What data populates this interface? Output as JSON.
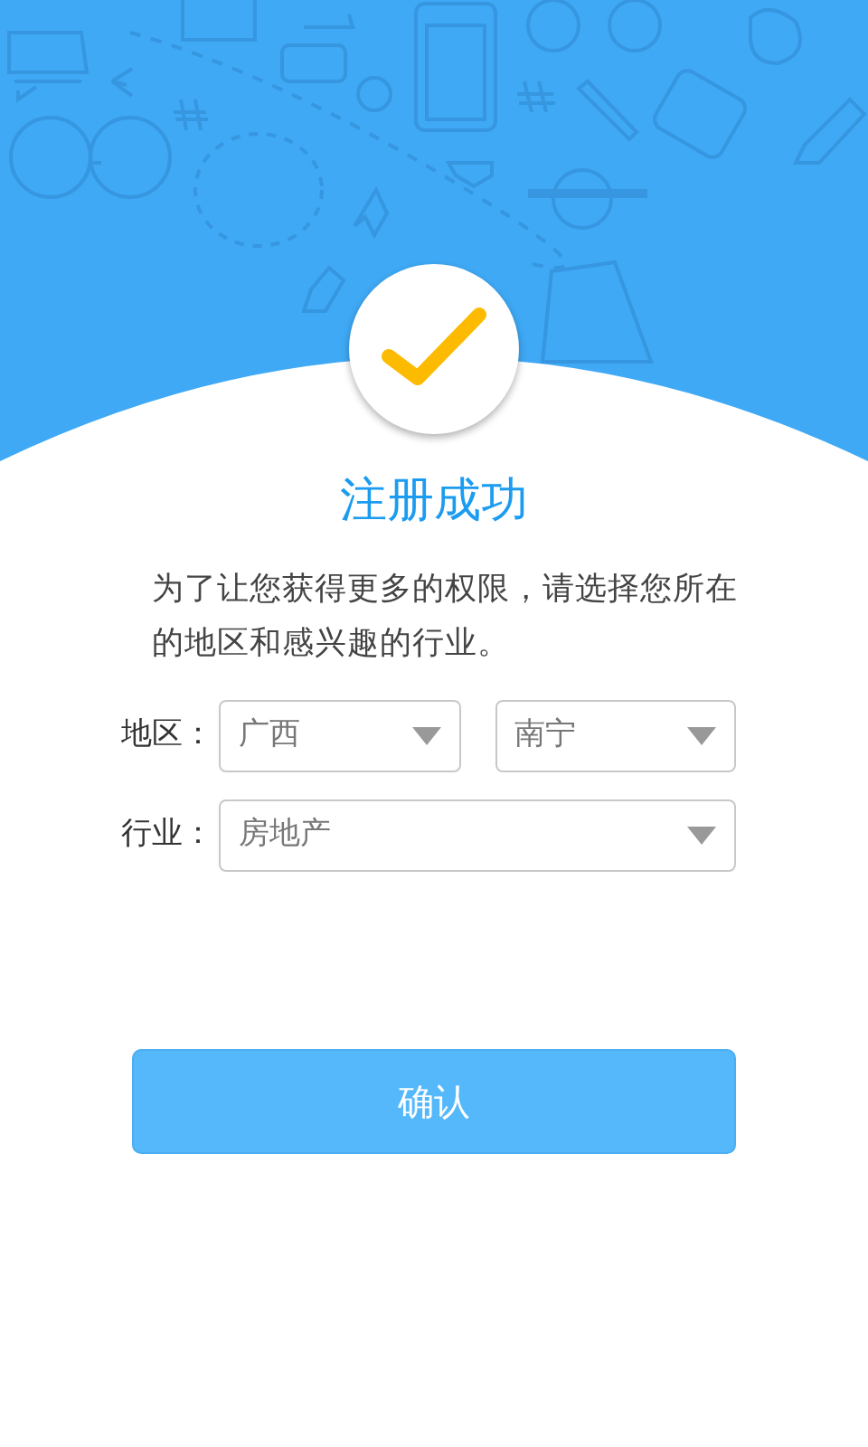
{
  "title": "注册成功",
  "message": "为了让您获得更多的权限，请选择您所在的地区和感兴趣的行业。",
  "fields": [
    {
      "label": "地区：",
      "selects": [
        {
          "value": "广西"
        },
        {
          "value": "南宁"
        }
      ]
    },
    {
      "label": "行业：",
      "selects": [
        {
          "value": "房地产"
        }
      ]
    }
  ],
  "button": "确认"
}
